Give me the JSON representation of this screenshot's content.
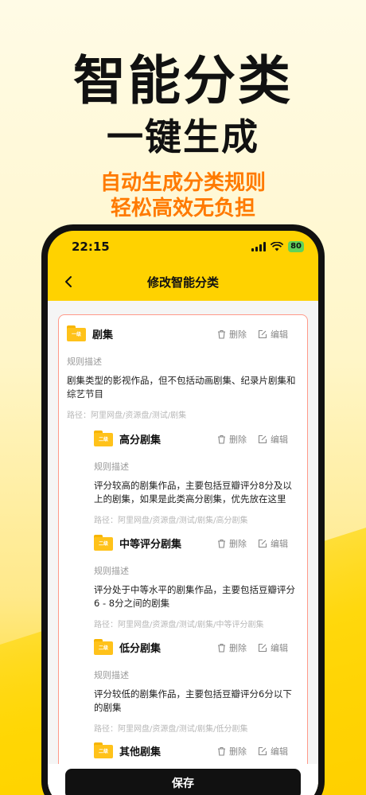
{
  "promo": {
    "title_line1": "智能分类",
    "title_line2": "一键生成",
    "subtitle_line1": "自动生成分类规则",
    "subtitle_line2": "轻松高效无负担"
  },
  "status_bar": {
    "time": "22:15",
    "battery": "80"
  },
  "nav": {
    "title": "修改智能分类",
    "back_icon": "chevron-left-icon"
  },
  "actions": {
    "delete": "删除",
    "edit": "编辑"
  },
  "rules": [
    {
      "badge": "一级",
      "name": "剧集",
      "desc_label": "规则描述",
      "desc": "剧集类型的影视作品，但不包括动画剧集、纪录片剧集和综艺节目",
      "path": "路径：阿里网盘/资源盘/测试/剧集"
    },
    {
      "badge": "二级",
      "name": "高分剧集",
      "desc_label": "规则描述",
      "desc": "评分较高的剧集作品，主要包括豆瓣评分8分及以上的剧集，如果是此类高分剧集，优先放在这里",
      "path": "路径：阿里网盘/资源盘/测试/剧集/高分剧集"
    },
    {
      "badge": "二级",
      "name": "中等评分剧集",
      "desc_label": "规则描述",
      "desc": "评分处于中等水平的剧集作品，主要包括豆瓣评分6 - 8分之间的剧集",
      "path": "路径：阿里网盘/资源盘/测试/剧集/中等评分剧集"
    },
    {
      "badge": "二级",
      "name": "低分剧集",
      "desc_label": "规则描述",
      "desc": "评分较低的剧集作品，主要包括豆瓣评分6分以下的剧集",
      "path": "路径：阿里网盘/资源盘/测试/剧集/低分剧集"
    },
    {
      "badge": "二级",
      "name": "其他剧集"
    }
  ],
  "save_label": "保存",
  "colors": {
    "accent": "#ffd200",
    "subtitle": "#ff7a00",
    "card_border": "#ff9a8a"
  }
}
